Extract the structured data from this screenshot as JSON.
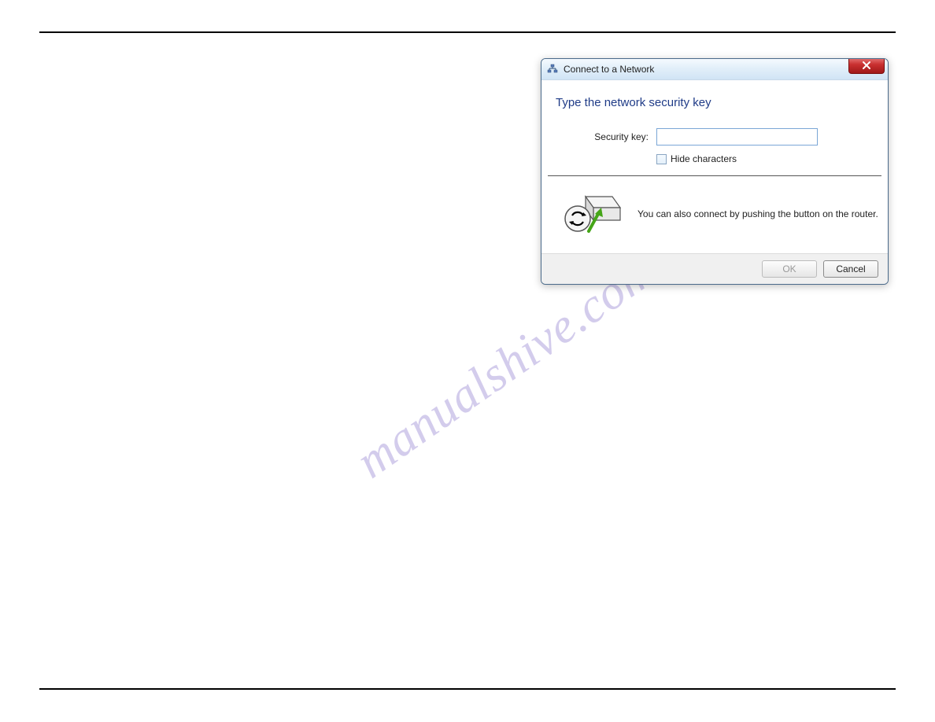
{
  "watermark": "manualshive.com",
  "dialog": {
    "title": "Connect to a Network",
    "heading": "Type the network security key",
    "security_key_label": "Security key:",
    "security_key_value": "",
    "hide_characters_label": "Hide characters",
    "wps_message": "You can also connect by pushing the button on the router.",
    "ok_label": "OK",
    "cancel_label": "Cancel"
  }
}
